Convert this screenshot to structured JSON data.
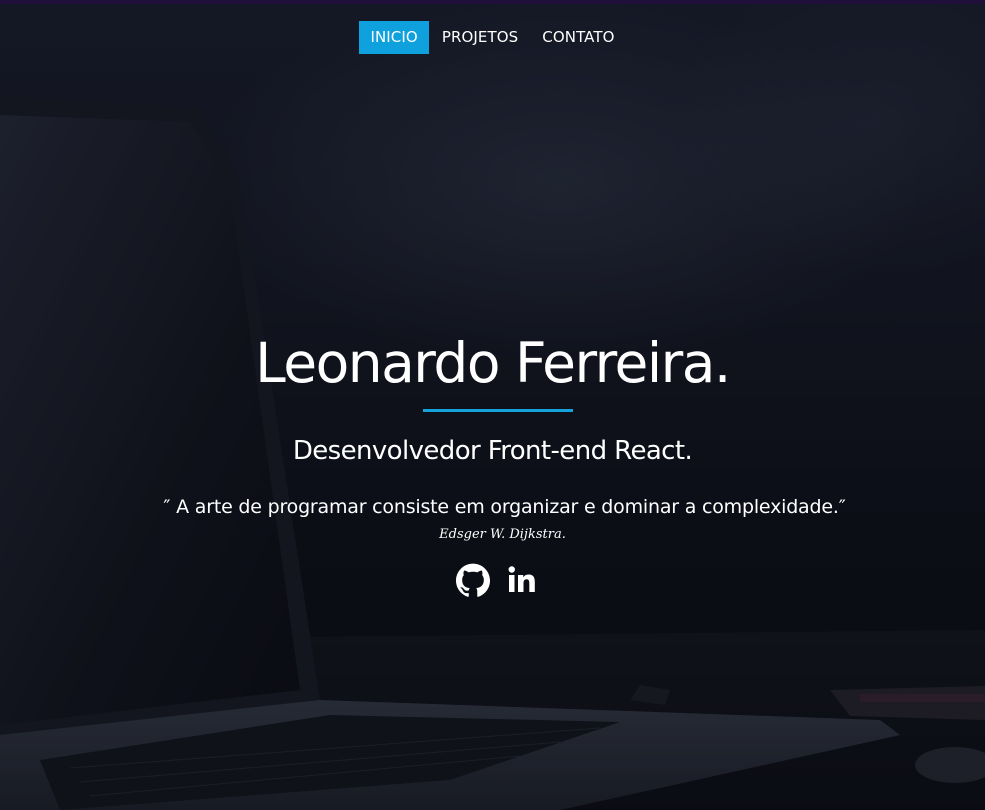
{
  "nav": {
    "items": [
      {
        "label": "INICIO",
        "active": true
      },
      {
        "label": "PROJETOS",
        "active": false
      },
      {
        "label": "CONTATO",
        "active": false
      }
    ]
  },
  "hero": {
    "name": "Leonardo Ferreira.",
    "role": "Desenvolvedor Front-end React.",
    "quote": "″ A arte de programar consiste em organizar e dominar a complexidade.″",
    "author": "Edsger W. Dijkstra."
  },
  "socials": [
    {
      "icon": "github-icon"
    },
    {
      "icon": "linkedin-icon"
    }
  ],
  "colors": {
    "accent": "#0ea1dd",
    "text": "#ffffff",
    "background": "#0b0d14"
  }
}
